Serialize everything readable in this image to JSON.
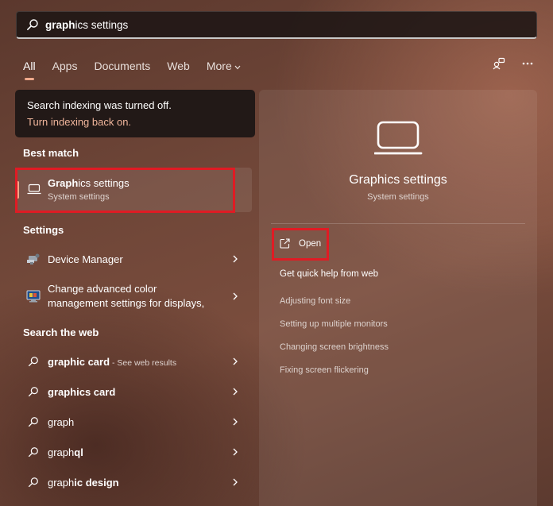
{
  "search": {
    "query_bold": "graph",
    "query_rest": "ics settings"
  },
  "tabs": [
    {
      "label": "All",
      "active": true
    },
    {
      "label": "Apps"
    },
    {
      "label": "Documents"
    },
    {
      "label": "Web"
    },
    {
      "label": "More"
    }
  ],
  "top_icons": [
    "share-icon",
    "more-options-icon"
  ],
  "indexing": {
    "message": "Search indexing was turned off.",
    "link": "Turn indexing back on."
  },
  "best_match": {
    "header": "Best match",
    "title_bold": "Graph",
    "title_rest": "ics settings",
    "subtitle": "System settings",
    "icon": "laptop-icon"
  },
  "settings": {
    "header": "Settings",
    "items": [
      {
        "label": "Device Manager",
        "icon": "device-manager-icon"
      },
      {
        "label_line1": "Change advanced color",
        "label_line2": "management settings for displays,",
        "icon": "color-management-icon"
      }
    ]
  },
  "web": {
    "header": "Search the web",
    "items": [
      {
        "bold": "graphic card",
        "rest": "",
        "suffix": " - See web results"
      },
      {
        "bold": "graph",
        "rest": "ics card",
        "rest_bold": true
      },
      {
        "bold": "graph",
        "rest": ""
      },
      {
        "bold": "graph",
        "rest": "ql",
        "rest_bold": true
      },
      {
        "bold": "graph",
        "rest": "ic design",
        "rest_bold": true
      }
    ]
  },
  "detail": {
    "icon": "laptop-icon",
    "title": "Graphics settings",
    "subtitle": "System settings",
    "open_label": "Open",
    "quick_help": "Get quick help from web",
    "links": [
      "Adjusting font size",
      "Setting up multiple monitors",
      "Changing screen brightness",
      "Fixing screen flickering"
    ]
  },
  "colors": {
    "accent": "#f0a98c",
    "highlight_box": "#e01b24",
    "link": "#f0b59b"
  }
}
